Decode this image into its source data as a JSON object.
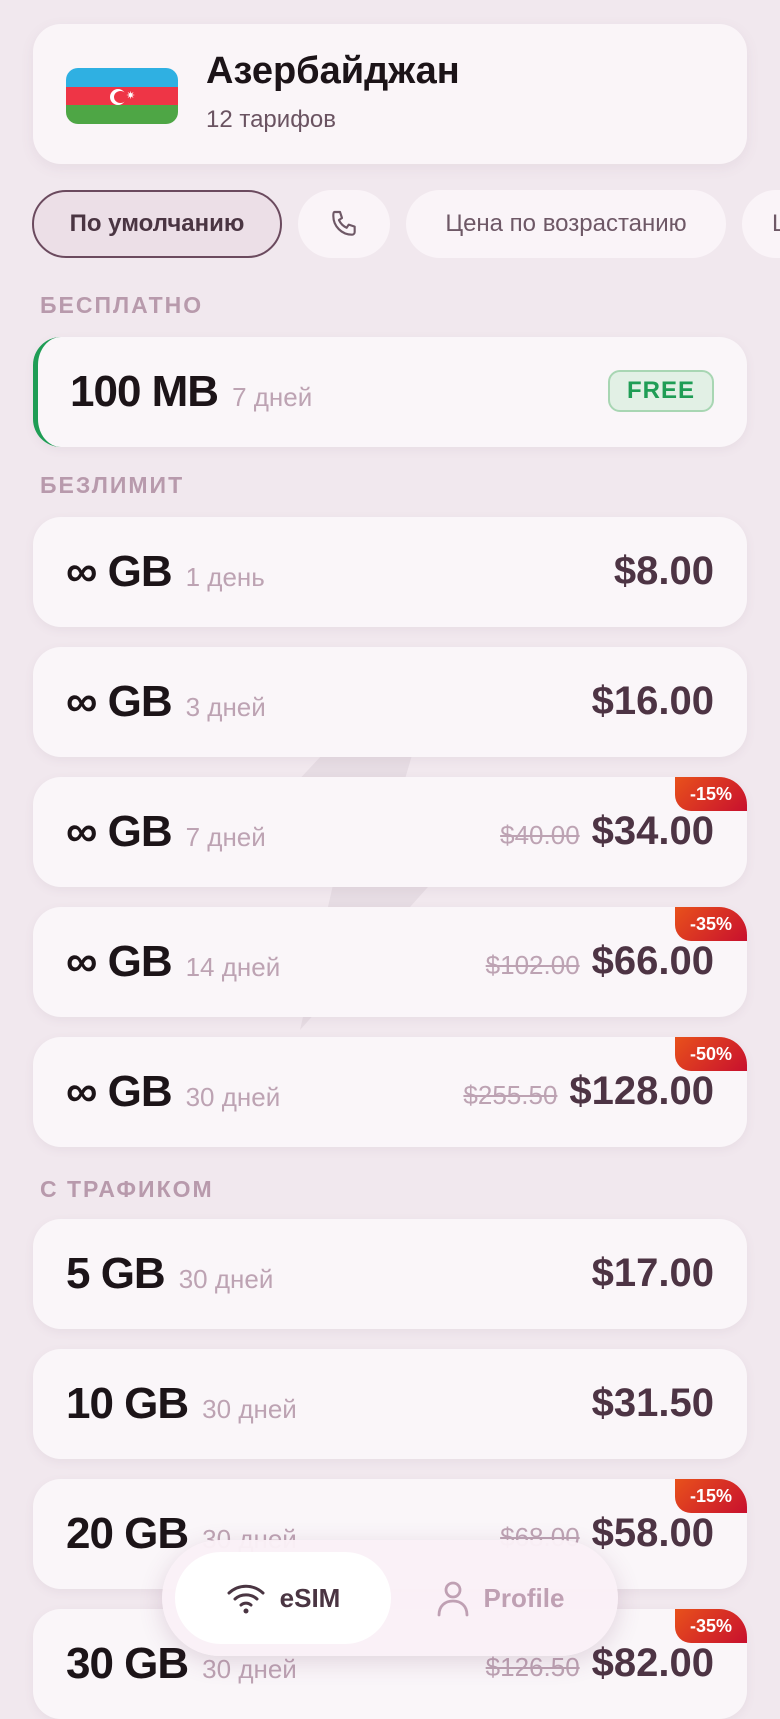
{
  "country": {
    "name": "Азербайджан",
    "subtitle": "12 тарифов",
    "flag_icon": "azerbaijan-flag-icon"
  },
  "filters": [
    {
      "label": "По умолчанию",
      "active": true
    },
    {
      "label": "",
      "icon": "phone-icon"
    },
    {
      "label": "Цена по возрастанию"
    },
    {
      "label": "Ц"
    }
  ],
  "sections": {
    "free": "БЕСПЛАТНО",
    "unlimited": "БЕЗЛИМИТ",
    "traffic": "С ТРАФИКОМ"
  },
  "free_plan": {
    "size": "100 MB",
    "duration": "7 дней",
    "badge": "FREE"
  },
  "unlimited_plans": [
    {
      "size": "∞ GB",
      "duration": "1 день",
      "price": "$8.00",
      "old_price": "",
      "discount": ""
    },
    {
      "size": "∞ GB",
      "duration": "3 дней",
      "price": "$16.00",
      "old_price": "",
      "discount": ""
    },
    {
      "size": "∞ GB",
      "duration": "7 дней",
      "price": "$34.00",
      "old_price": "$40.00",
      "discount": "-15%"
    },
    {
      "size": "∞ GB",
      "duration": "14 дней",
      "price": "$66.00",
      "old_price": "$102.00",
      "discount": "-35%"
    },
    {
      "size": "∞ GB",
      "duration": "30 дней",
      "price": "$128.00",
      "old_price": "$255.50",
      "discount": "-50%"
    }
  ],
  "traffic_plans": [
    {
      "size": "5 GB",
      "duration": "30 дней",
      "price": "$17.00",
      "old_price": "",
      "discount": ""
    },
    {
      "size": "10 GB",
      "duration": "30 дней",
      "price": "$31.50",
      "old_price": "",
      "discount": ""
    },
    {
      "size": "20 GB",
      "duration": "30 дней",
      "price": "$58.00",
      "old_price": "$68.00",
      "discount": "-15%"
    },
    {
      "size": "30 GB",
      "duration": "30 дней",
      "price": "$82.00",
      "old_price": "$126.50",
      "discount": "-35%"
    }
  ],
  "tabbar": {
    "esim": {
      "label": "eSIM",
      "icon": "wifi-icon",
      "active": true
    },
    "profile": {
      "label": "Profile",
      "icon": "user-icon",
      "active": false
    }
  },
  "colors": {
    "accent": "#4d3444",
    "free_green": "#1f9d55",
    "discount_red": "#c8102e",
    "background": "#f1e8ee"
  }
}
